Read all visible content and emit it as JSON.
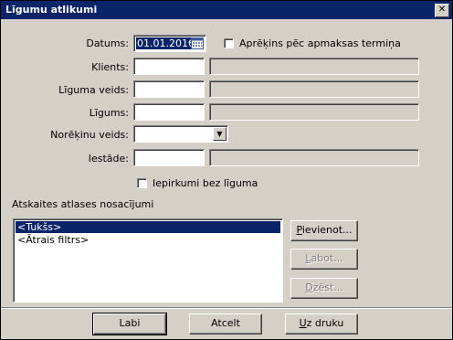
{
  "window": {
    "title": "Līgumu atlikumi",
    "close_label": "✕"
  },
  "form": {
    "datums_label": "Datums:",
    "datums_value": "01.01.2016",
    "aprekins_label": "Aprēķins pēc apmaksas termiņa",
    "aprekins_checked": false,
    "klients_label": "Klients:",
    "liguma_veids_label": "Līguma veids:",
    "ligums_label": "Līgums:",
    "norekinu_veids_label": "Norēķinu veids:",
    "iestade_label": "Iestāde:",
    "iepirkumi_label": "Iepirkumi bez līguma",
    "iepirkumi_checked": false
  },
  "filters": {
    "section_label": "Atskaites atlases nosacījumi",
    "items": [
      "<Tukšs>",
      "<Ātrais filtrs>"
    ],
    "selected_index": 0,
    "add_label_u": "P",
    "add_label_rest": "ievienot...",
    "edit_label_u": "L",
    "edit_label_rest": "abot...",
    "delete_label_u": "D",
    "delete_label_rest": "zēst..."
  },
  "buttons": {
    "ok_label": "Labi",
    "cancel_label": "Atcelt",
    "print_label_u": "U",
    "print_label_rest": "z druku"
  },
  "icons": {
    "calendar": "calendar-icon",
    "dropdown": "chevron-down-icon",
    "close": "close-icon"
  }
}
